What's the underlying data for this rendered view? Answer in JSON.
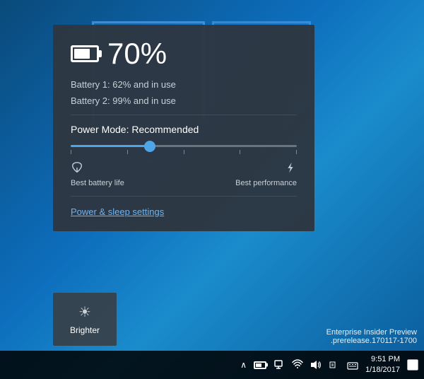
{
  "desktop": {
    "background": "windows10-desktop"
  },
  "battery_panel": {
    "percentage": "70%",
    "battery1": "Battery 1: 62% and in use",
    "battery2": "Battery 2: 99% and in use",
    "power_mode_label": "Power Mode: Recommended",
    "slider_fill_percent": 35,
    "best_battery_label": "Best battery life",
    "best_performance_label": "Best performance",
    "power_link": "Power & sleep settings"
  },
  "brighter_panel": {
    "label": "Brighter",
    "icon": "☀"
  },
  "taskbar": {
    "chevron_label": "^",
    "time": "9:51 PM",
    "date": "1/18/2017",
    "notification_icon": "□"
  },
  "watermark": {
    "line1": "Enterprise Insider Preview",
    "line2": ".prerelease.170117-1700"
  }
}
